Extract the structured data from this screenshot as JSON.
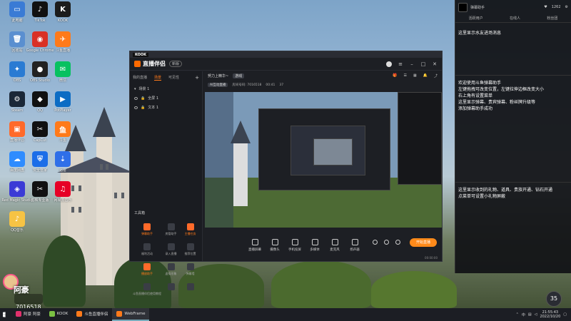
{
  "desktop": {
    "icons": [
      {
        "label": "此电脑",
        "color": "#3a7bd5",
        "glyph": "▭"
      },
      {
        "label": "TikTok",
        "color": "#111",
        "glyph": "♪"
      },
      {
        "label": "KOOK",
        "color": "#1c1c1c",
        "glyph": "K"
      },
      {
        "label": "回收站",
        "color": "#5a8fd0",
        "glyph": "🗑"
      },
      {
        "label": "Google Chrome",
        "color": "#d93025",
        "glyph": "◉"
      },
      {
        "label": "斗鱼直播",
        "color": "#ff7a1a",
        "glyph": "✈"
      },
      {
        "label": "OBS",
        "color": "#2a7bd3",
        "glyph": "✦"
      },
      {
        "label": "OBS Studio",
        "color": "#222",
        "glyph": "●"
      },
      {
        "label": "微信",
        "color": "#07c160",
        "glyph": "✉"
      },
      {
        "label": "Steam",
        "color": "#1b2838",
        "glyph": "⚙"
      },
      {
        "label": "QQ",
        "color": "#111",
        "glyph": "◆"
      },
      {
        "label": "PotPlayer",
        "color": "#0c6cc4",
        "glyph": "▶"
      },
      {
        "label": "直播伴侣",
        "color": "#ff6a2a",
        "glyph": "▣"
      },
      {
        "label": "CapCut",
        "color": "#111",
        "glyph": "✂"
      },
      {
        "label": "斗鱼",
        "color": "#ff7a1a",
        "glyph": "鱼"
      },
      {
        "label": "百度网盘",
        "color": "#2f8cff",
        "glyph": "☁"
      },
      {
        "label": "安全管家",
        "color": "#1c6ee8",
        "glyph": "⛨"
      },
      {
        "label": "迅雷",
        "color": "#2f6fe8",
        "glyph": "⇣"
      },
      {
        "label": "Red Magic Studio",
        "color": "#3b3bd6",
        "glyph": "◈"
      },
      {
        "label": "剪映专业版",
        "color": "#111",
        "glyph": "✂"
      },
      {
        "label": "网易云音乐",
        "color": "#e60026",
        "glyph": "♫"
      },
      {
        "label": "QQ音乐",
        "color": "#f6c344",
        "glyph": "♪"
      }
    ]
  },
  "streamer_widget": {
    "name": "阿豪",
    "id": "7016518"
  },
  "app": {
    "top_tag": "KOOK",
    "title": "直播伴侣",
    "version": "新版",
    "tabs": [
      "我的直播",
      "场景",
      "可见性"
    ],
    "scenes": [
      "全屏 1",
      "文本 1"
    ],
    "scene_group": "场景 1",
    "room_title": "努力上精华~",
    "room_chip": "游戏",
    "stats": {
      "platform_tag": "AI互动直播",
      "room_label": "房间号码: 7016518",
      "time": "00:41",
      "viewers": "37"
    },
    "tools_title": "工具箱",
    "tools": [
      {
        "label": "弹幕助手",
        "orange": true
      },
      {
        "label": "房管助手",
        "orange": false
      },
      {
        "label": "主播任务",
        "orange": true
      },
      {
        "label": "福利活动",
        "orange": false
      },
      {
        "label": "录入直播",
        "orange": false
      },
      {
        "label": "推荐位置",
        "orange": false
      },
      {
        "label": "播放助手",
        "orange": true
      },
      {
        "label": "虚拟形象",
        "orange": false
      },
      {
        "label": "弹幕墙",
        "orange": false
      },
      {
        "label": "斗鱼直播伴侣使用教程",
        "orange": false
      },
      {
        "label": "",
        "orange": false
      },
      {
        "label": "",
        "orange": false
      }
    ],
    "bottom_buttons": [
      "直播屏幕",
      "摄像头",
      "手机投屏",
      "多媒体",
      "麦克风",
      "扬声器"
    ],
    "go_live": "开始直播",
    "status": "00:00:00"
  },
  "right_panel": {
    "user": "弹幕助手",
    "likes": "1262",
    "tabs": [
      "活跃用户",
      "在线人",
      "粉丝团"
    ],
    "welcome_line": "这里显示水友进场消息",
    "intro_lines": [
      "欢迎使用斗鱼弹幕助手",
      "左键拖拽可改变位置，左键拉伸边框改变大小",
      "右上角有设置菜单",
      "这里显示弹幕、贵宾弹幕、粉丝牌升级等",
      "添加弹幕助手成功"
    ],
    "gift_lines": [
      "这里显示收到的礼物、道具、贵族开通、钻石开通",
      "点菜单可设置小礼物屏蔽"
    ]
  },
  "taskbar": {
    "tasks": [
      {
        "label": "阿豪 阿豪",
        "color": "#e1306c",
        "active": false
      },
      {
        "label": "KOOK",
        "color": "#7bc043",
        "active": false
      },
      {
        "label": "斗鱼直播伴侣",
        "color": "#ff7a1a",
        "active": false
      },
      {
        "label": "WebFrame",
        "color": "#ff7a1a",
        "active": true
      }
    ],
    "time": "21:55:43",
    "date": "2022/10/20",
    "ime": "中"
  },
  "float_badge": "35"
}
